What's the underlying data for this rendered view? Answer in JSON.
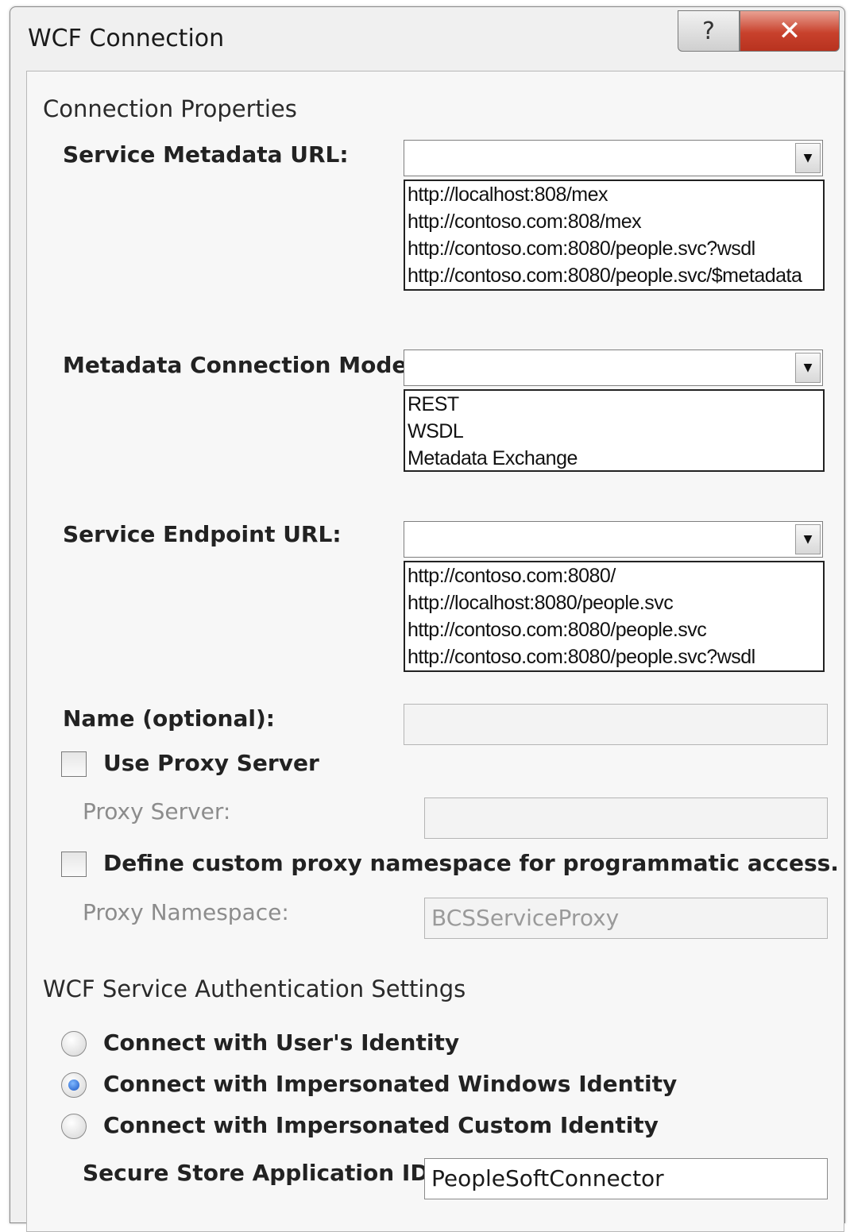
{
  "window": {
    "title": "WCF Connection",
    "help_glyph": "?",
    "close_glyph": "✕"
  },
  "connection": {
    "heading": "Connection Properties",
    "metadata_url": {
      "label": "Service Metadata URL:",
      "value": "",
      "options": [
        "http://localhost:808/mex",
        "http://contoso.com:808/mex",
        "http://contoso.com:8080/people.svc?wsdl",
        "http://contoso.com:8080/people.svc/$metadata"
      ]
    },
    "mode": {
      "label": "Metadata Connection Mode:",
      "value": "",
      "options": [
        "REST",
        "WSDL",
        "Metadata Exchange"
      ]
    },
    "endpoint_url": {
      "label": "Service Endpoint URL:",
      "value": "",
      "options": [
        "http://contoso.com:8080/",
        "http://localhost:8080/people.svc",
        "http://contoso.com:8080/people.svc",
        "http://contoso.com:8080/people.svc?wsdl"
      ]
    },
    "name": {
      "label": "Name (optional):",
      "value": ""
    },
    "use_proxy": {
      "label": "Use Proxy Server",
      "checked": false
    },
    "proxy_server": {
      "label": "Proxy Server:",
      "value": ""
    },
    "custom_ns": {
      "label": "Define custom proxy namespace for programmatic access.",
      "checked": false
    },
    "proxy_namespace": {
      "label": "Proxy Namespace:",
      "value": "BCSServiceProxy"
    }
  },
  "auth": {
    "heading": "WCF Service Authentication Settings",
    "options": [
      {
        "label": "Connect with User's Identity",
        "checked": false
      },
      {
        "label": "Connect with Impersonated Windows Identity",
        "checked": true
      },
      {
        "label": "Connect with Impersonated Custom Identity",
        "checked": false
      }
    ],
    "secure_store": {
      "label": "Secure Store Application ID:",
      "value": "PeopleSoftConnector"
    }
  }
}
